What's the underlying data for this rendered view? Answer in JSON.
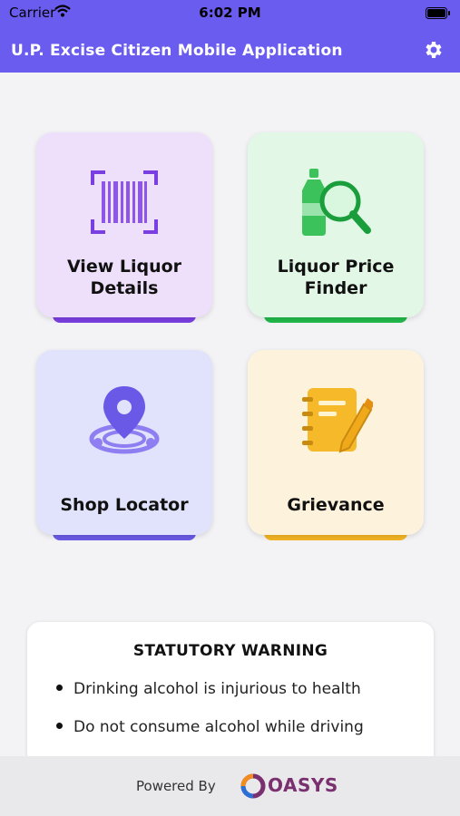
{
  "status_bar": {
    "carrier": "Carrier",
    "time": "6:02 PM"
  },
  "header": {
    "title": "U.P. Excise Citizen Mobile Application",
    "settings_icon": "gear-icon"
  },
  "tiles": [
    {
      "label": "View Liquor Details",
      "line1": "View Liquor",
      "line2": "Details",
      "icon": "barcode-scan-icon",
      "bg": "#eedffb",
      "accent": "#7a3fe0"
    },
    {
      "label": "Liquor Price Finder",
      "line1": "Liquor Price",
      "line2": "Finder",
      "icon": "bottle-search-icon",
      "bg": "#e2f7e6",
      "accent": "#22b84a"
    },
    {
      "label": "Shop Locator",
      "line1": "Shop Locator",
      "icon": "location-pin-icon",
      "bg": "#e1e2fb",
      "accent": "#6a59e6"
    },
    {
      "label": "Grievance",
      "line1": "Grievance",
      "icon": "notepad-pencil-icon",
      "bg": "#fdf3dd",
      "accent": "#f3b522"
    }
  ],
  "warning": {
    "title": "STATUTORY WARNING",
    "items": [
      "Drinking alcohol is injurious to health",
      "Do not consume alcohol while driving"
    ]
  },
  "footer": {
    "powered_by": "Powered By",
    "brand": "OASYS"
  },
  "colors": {
    "primary": "#6b5cf0",
    "background": "#f3f3f6"
  }
}
